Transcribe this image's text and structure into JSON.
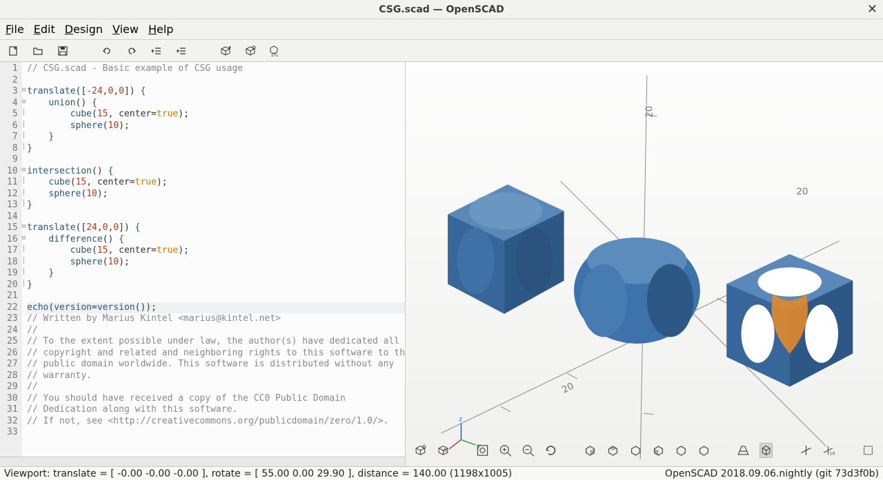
{
  "window": {
    "title": "CSG.scad — OpenSCAD"
  },
  "menu": {
    "file": "File",
    "edit": "Edit",
    "design": "Design",
    "view": "View",
    "help": "Help"
  },
  "code_lines": [
    {
      "n": 1,
      "fold": "",
      "segs": [
        {
          "t": "// CSG.scad - Basic example of CSG usage",
          "c": "c-comment"
        }
      ]
    },
    {
      "n": 2,
      "fold": "",
      "segs": []
    },
    {
      "n": 3,
      "fold": "⊟",
      "segs": [
        {
          "t": "translate",
          "c": "c-fn"
        },
        {
          "t": "([",
          "c": "c-pun"
        },
        {
          "t": "-24",
          "c": "c-num"
        },
        {
          "t": ",",
          "c": "c-pun"
        },
        {
          "t": "0",
          "c": "c-num"
        },
        {
          "t": ",",
          "c": "c-pun"
        },
        {
          "t": "0",
          "c": "c-num"
        },
        {
          "t": "]) ",
          "c": "c-pun"
        },
        {
          "t": "{",
          "c": "c-brace"
        }
      ]
    },
    {
      "n": 4,
      "fold": "⊟",
      "segs": [
        {
          "t": "    ",
          "c": ""
        },
        {
          "t": "union",
          "c": "c-fn"
        },
        {
          "t": "() ",
          "c": "c-pun"
        },
        {
          "t": "{",
          "c": "c-brace"
        }
      ]
    },
    {
      "n": 5,
      "fold": "│",
      "segs": [
        {
          "t": "        ",
          "c": ""
        },
        {
          "t": "cube",
          "c": "c-fn"
        },
        {
          "t": "(",
          "c": "c-pun"
        },
        {
          "t": "15",
          "c": "c-num"
        },
        {
          "t": ", center=",
          "c": "c-pun"
        },
        {
          "t": "true",
          "c": "c-true"
        },
        {
          "t": ");",
          "c": "c-pun"
        }
      ]
    },
    {
      "n": 6,
      "fold": "│",
      "segs": [
        {
          "t": "        ",
          "c": ""
        },
        {
          "t": "sphere",
          "c": "c-fn"
        },
        {
          "t": "(",
          "c": "c-pun"
        },
        {
          "t": "10",
          "c": "c-num"
        },
        {
          "t": ");",
          "c": "c-pun"
        }
      ]
    },
    {
      "n": 7,
      "fold": "│",
      "segs": [
        {
          "t": "    ",
          "c": ""
        },
        {
          "t": "}",
          "c": "c-brace"
        }
      ]
    },
    {
      "n": 8,
      "fold": "│",
      "segs": [
        {
          "t": "}",
          "c": "c-brace"
        }
      ]
    },
    {
      "n": 9,
      "fold": "",
      "segs": []
    },
    {
      "n": 10,
      "fold": "⊟",
      "segs": [
        {
          "t": "intersection",
          "c": "c-fn"
        },
        {
          "t": "() ",
          "c": "c-pun"
        },
        {
          "t": "{",
          "c": "c-brace"
        }
      ]
    },
    {
      "n": 11,
      "fold": "│",
      "segs": [
        {
          "t": "    ",
          "c": ""
        },
        {
          "t": "cube",
          "c": "c-fn"
        },
        {
          "t": "(",
          "c": "c-pun"
        },
        {
          "t": "15",
          "c": "c-num"
        },
        {
          "t": ", center=",
          "c": "c-pun"
        },
        {
          "t": "true",
          "c": "c-true"
        },
        {
          "t": ");",
          "c": "c-pun"
        }
      ]
    },
    {
      "n": 12,
      "fold": "│",
      "segs": [
        {
          "t": "    ",
          "c": ""
        },
        {
          "t": "sphere",
          "c": "c-fn"
        },
        {
          "t": "(",
          "c": "c-pun"
        },
        {
          "t": "10",
          "c": "c-num"
        },
        {
          "t": ");",
          "c": "c-pun"
        }
      ]
    },
    {
      "n": 13,
      "fold": "│",
      "segs": [
        {
          "t": "}",
          "c": "c-brace"
        }
      ]
    },
    {
      "n": 14,
      "fold": "",
      "segs": []
    },
    {
      "n": 15,
      "fold": "⊟",
      "segs": [
        {
          "t": "translate",
          "c": "c-fn"
        },
        {
          "t": "([",
          "c": "c-pun"
        },
        {
          "t": "24",
          "c": "c-num"
        },
        {
          "t": ",",
          "c": "c-pun"
        },
        {
          "t": "0",
          "c": "c-num"
        },
        {
          "t": ",",
          "c": "c-pun"
        },
        {
          "t": "0",
          "c": "c-num"
        },
        {
          "t": "]) ",
          "c": "c-pun"
        },
        {
          "t": "{",
          "c": "c-brace"
        }
      ]
    },
    {
      "n": 16,
      "fold": "⊟",
      "segs": [
        {
          "t": "    ",
          "c": ""
        },
        {
          "t": "difference",
          "c": "c-fn"
        },
        {
          "t": "() ",
          "c": "c-pun"
        },
        {
          "t": "{",
          "c": "c-brace"
        }
      ]
    },
    {
      "n": 17,
      "fold": "│",
      "segs": [
        {
          "t": "        ",
          "c": ""
        },
        {
          "t": "cube",
          "c": "c-fn"
        },
        {
          "t": "(",
          "c": "c-pun"
        },
        {
          "t": "15",
          "c": "c-num"
        },
        {
          "t": ", center=",
          "c": "c-pun"
        },
        {
          "t": "true",
          "c": "c-true"
        },
        {
          "t": ");",
          "c": "c-pun"
        }
      ]
    },
    {
      "n": 18,
      "fold": "│",
      "segs": [
        {
          "t": "        ",
          "c": ""
        },
        {
          "t": "sphere",
          "c": "c-fn"
        },
        {
          "t": "(",
          "c": "c-pun"
        },
        {
          "t": "10",
          "c": "c-num"
        },
        {
          "t": ");",
          "c": "c-pun"
        }
      ]
    },
    {
      "n": 19,
      "fold": "│",
      "segs": [
        {
          "t": "    ",
          "c": ""
        },
        {
          "t": "}",
          "c": "c-brace"
        }
      ]
    },
    {
      "n": 20,
      "fold": "│",
      "segs": [
        {
          "t": "}",
          "c": "c-brace"
        }
      ]
    },
    {
      "n": 21,
      "fold": "",
      "segs": []
    },
    {
      "n": 22,
      "fold": "",
      "cur": true,
      "segs": [
        {
          "t": "echo",
          "c": "c-fn"
        },
        {
          "t": "(",
          "c": "c-pun"
        },
        {
          "t": "version",
          "c": "c-fn"
        },
        {
          "t": "=",
          "c": "c-pun"
        },
        {
          "t": "version",
          "c": "c-fn"
        },
        {
          "t": "());",
          "c": "c-pun"
        }
      ]
    },
    {
      "n": 23,
      "fold": "",
      "segs": [
        {
          "t": "// Written by Marius Kintel <marius@kintel.net>",
          "c": "c-comment"
        }
      ]
    },
    {
      "n": 24,
      "fold": "",
      "segs": [
        {
          "t": "//",
          "c": "c-comment"
        }
      ]
    },
    {
      "n": 25,
      "fold": "",
      "segs": [
        {
          "t": "// To the extent possible under law, the author(s) have dedicated all",
          "c": "c-comment"
        }
      ]
    },
    {
      "n": 26,
      "fold": "",
      "segs": [
        {
          "t": "// copyright and related and neighboring rights to this software to the",
          "c": "c-comment"
        }
      ]
    },
    {
      "n": 27,
      "fold": "",
      "segs": [
        {
          "t": "// public domain worldwide. This software is distributed without any",
          "c": "c-comment"
        }
      ]
    },
    {
      "n": 28,
      "fold": "",
      "segs": [
        {
          "t": "// warranty.",
          "c": "c-comment"
        }
      ]
    },
    {
      "n": 29,
      "fold": "",
      "segs": [
        {
          "t": "//",
          "c": "c-comment"
        }
      ]
    },
    {
      "n": 30,
      "fold": "",
      "segs": [
        {
          "t": "// You should have received a copy of the CC0 Public Domain",
          "c": "c-comment"
        }
      ]
    },
    {
      "n": 31,
      "fold": "",
      "segs": [
        {
          "t": "// Dedication along with this software.",
          "c": "c-comment"
        }
      ]
    },
    {
      "n": 32,
      "fold": "",
      "segs": [
        {
          "t": "// If not, see <http://creativecommons.org/publicdomain/zero/1.0/>.",
          "c": "c-comment"
        }
      ]
    },
    {
      "n": 33,
      "fold": "",
      "segs": []
    }
  ],
  "axis_ticks": [
    "20",
    "20",
    "20"
  ],
  "status": {
    "left": "Viewport: translate = [ -0.00 -0.00 -0.00 ], rotate = [ 55.00 0.00 29.90 ], distance = 140.00 (1198x1005)",
    "right": "OpenSCAD 2018.09.06.nightly (git 73d3f0b)"
  }
}
